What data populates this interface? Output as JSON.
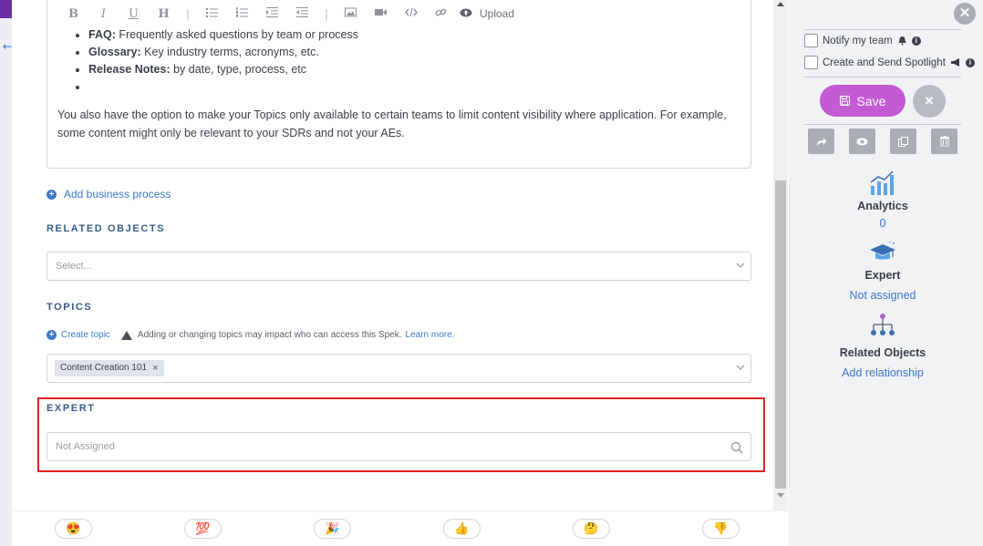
{
  "editor": {
    "toolbar": [
      "B",
      "I",
      "U",
      "H",
      "|",
      "ul",
      "ol",
      "indent",
      "outdent",
      "|",
      "image",
      "video",
      "code",
      "link",
      "upload"
    ],
    "upload_label": "Upload",
    "bullets": [
      {
        "bold": "FAQ:",
        "text": " Frequently asked questions by team or process"
      },
      {
        "bold": "Glossary:",
        "text": " Key industry terms, acronyms, etc."
      },
      {
        "bold": "Release Notes:",
        "text": " by date, type, process, etc"
      },
      {
        "bold": "",
        "text": ""
      }
    ],
    "paragraph": "You also have the option to make your Topics only available to certain teams to limit content visibility where application. For example, some content might only be relevant to your SDRs and not your AEs."
  },
  "add_business_process": "Add business process",
  "related_objects": {
    "label": "RELATED OBJECTS",
    "placeholder": "Select..."
  },
  "topics": {
    "label": "TOPICS",
    "create_topic": "Create topic",
    "warning": "Adding or changing topics may impact who can access this Spek.",
    "learn_more": "Learn more.",
    "chips": [
      "Content Creation 101"
    ]
  },
  "expert": {
    "label": "EXPERT",
    "placeholder": "Not Assigned"
  },
  "reactions": [
    "😍",
    "💯",
    "🎉",
    "👍",
    "🤔",
    "👎"
  ],
  "panel": {
    "notify_label": "Notify my team",
    "spotlight_label": "Create and Send Spotlight",
    "save_label": "Save",
    "analytics_title": "Analytics",
    "analytics_value": "0",
    "expert_title": "Expert",
    "expert_value": "Not assigned",
    "related_title": "Related Objects",
    "related_value": "Add relationship"
  },
  "colors": {
    "accent": "#c35bd3",
    "link": "#3d78c9",
    "highlight": "#e02020"
  }
}
